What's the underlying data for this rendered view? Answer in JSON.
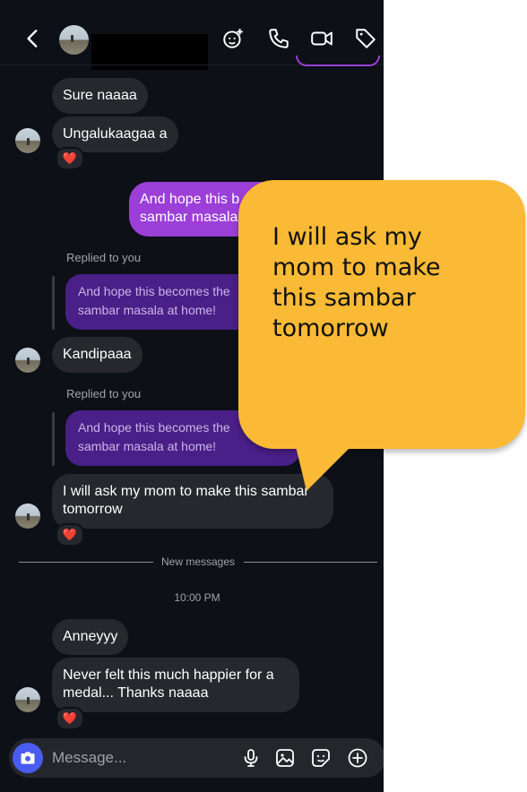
{
  "header": {
    "back_icon": "chevron-left-icon",
    "icons": [
      "sticker-add-icon",
      "phone-icon",
      "video-camera-icon",
      "tag-icon"
    ]
  },
  "messages": [
    {
      "text": "Sure naaaa"
    },
    {
      "text": "Ungalukaagaa a",
      "reaction": "❤️"
    },
    {
      "text": "And hope this becomes the sambar masala at home!"
    },
    {
      "text": "Kandipaaa"
    },
    {
      "text": "I will ask my mom to make this sambar tomorrow",
      "reaction": "❤️"
    },
    {
      "text": "Anneyyy"
    },
    {
      "text": "Never felt this much happier for a medal... Thanks naaaa",
      "reaction": "❤️"
    }
  ],
  "outgoing_visible": [
    "And hope this b",
    "sambar masala"
  ],
  "replies": [
    {
      "label": "Replied to you",
      "quote_line1": "And hope this becomes the",
      "quote_line2": "sambar masala at home!"
    },
    {
      "label": "Replied to you",
      "quote_line1": "And hope this becomes the",
      "quote_line2": "sambar masala at home!"
    }
  ],
  "divider": "New messages",
  "timestamp": "10:00 PM",
  "composer": {
    "placeholder": "Message..."
  },
  "callout": {
    "lines": [
      "I will ask my",
      "mom to make",
      "this sambar",
      "tomorrow"
    ]
  },
  "colors": {
    "background": "#0d1017",
    "incoming": "#26282e",
    "outgoing": "#9b3fd8",
    "quote": "#4a1f88",
    "callout": "#fbba35",
    "camera": "#4a5cf0"
  }
}
